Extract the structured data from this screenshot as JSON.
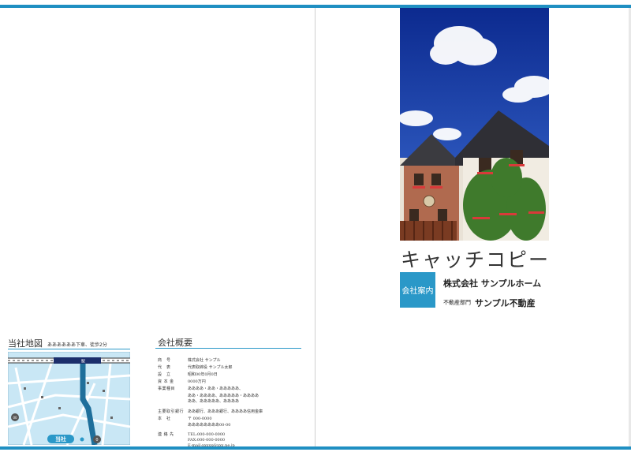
{
  "cover": {
    "catch_copy": "キャッチコピー",
    "badge": "会社案内",
    "company": "株式会社 サンプルホーム",
    "dept_small": "不動産部門",
    "dept_name": "サンプル不動産"
  },
  "map": {
    "title": "当社地図",
    "note": "ああああああ下車、徒歩2分",
    "station_label": "駅",
    "office_label": "当社",
    "route_left": "00",
    "route_right": "0"
  },
  "overview": {
    "title": "会社概要",
    "rows": [
      {
        "label": "商　号",
        "value": "株式会社 サンプル"
      },
      {
        "label": "代　表",
        "value": "代表取締役 サンプル太郎"
      },
      {
        "label": "設　立",
        "value": "昭和00年0月0日"
      },
      {
        "label": "資 本 金",
        "value": "0000万円"
      },
      {
        "label": "事業種目",
        "value": "ああああ・ああ・あああああ、"
      },
      {
        "label": "",
        "value": "ああ・ああああ、あああああ・ああああ"
      },
      {
        "label": "",
        "value": "ああ、あああああ、ああああ"
      },
      {
        "label": "主要取引銀行",
        "value": "ああ銀行、あああ銀行、ああああ信用金庫"
      },
      {
        "label": "本　社",
        "value": "〒 000-0000"
      },
      {
        "label": "",
        "value": "ああああああああ00-00"
      },
      {
        "label": "連 絡 先",
        "value": "TEL:000-000-0000"
      },
      {
        "label": "",
        "value": "FAX:000-000-0000"
      },
      {
        "label": "",
        "value": "E-mail:xxxxx@xxx.ne.jp"
      }
    ]
  },
  "colors": {
    "accent": "#2a98c8",
    "sky": "#1a3fa8"
  }
}
